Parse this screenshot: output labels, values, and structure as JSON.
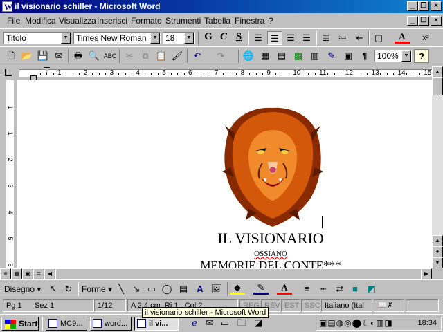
{
  "window": {
    "title": "il visionario schiller - Microsoft Word"
  },
  "menu": [
    "File",
    "Modifica",
    "Visualizza",
    "Inserisci",
    "Formato",
    "Strumenti",
    "Tabella",
    "Finestra",
    "?"
  ],
  "format_toolbar": {
    "style": "Titolo",
    "font": "Times New Roman",
    "size": "18",
    "bold": "G",
    "italic": "C",
    "underline": "S"
  },
  "std_toolbar": {
    "zoom": "100%"
  },
  "ruler": {
    "h_numbers": [
      "1",
      "2",
      "3",
      "4",
      "5",
      "6",
      "7",
      "8",
      "9",
      "10",
      "11",
      "12",
      "13",
      "14",
      "15"
    ],
    "v_numbers": [
      "1",
      "1",
      "2",
      "3",
      "4",
      "5",
      "6"
    ]
  },
  "document": {
    "title": "IL VISIONARIO",
    "subtitle": "OSSIANO",
    "line3": "MEMORIE DEL CONTE***"
  },
  "drawbar": {
    "disegno": "Disegno",
    "forme": "Forme"
  },
  "status": {
    "page": "Pg 1",
    "section": "Sez 1",
    "pages": "1/12",
    "at": "A 2,4 cm",
    "line": "Ri 1",
    "col": "Col 2",
    "rec": "REG",
    "rev": "REV",
    "est": "EST",
    "ssc": "SSC",
    "language": "Italiano (Ital"
  },
  "taskbar": {
    "start": "Start",
    "tasks": [
      "MC9...",
      "word...",
      "il vi..."
    ],
    "clock": "18:34"
  },
  "tooltip": "il visionario schiller - Microsoft Word",
  "colors": {
    "title_bar": "#000080",
    "face": "#c0c0c0",
    "font_color": "#ff0000",
    "highlight": "#ffff00"
  }
}
